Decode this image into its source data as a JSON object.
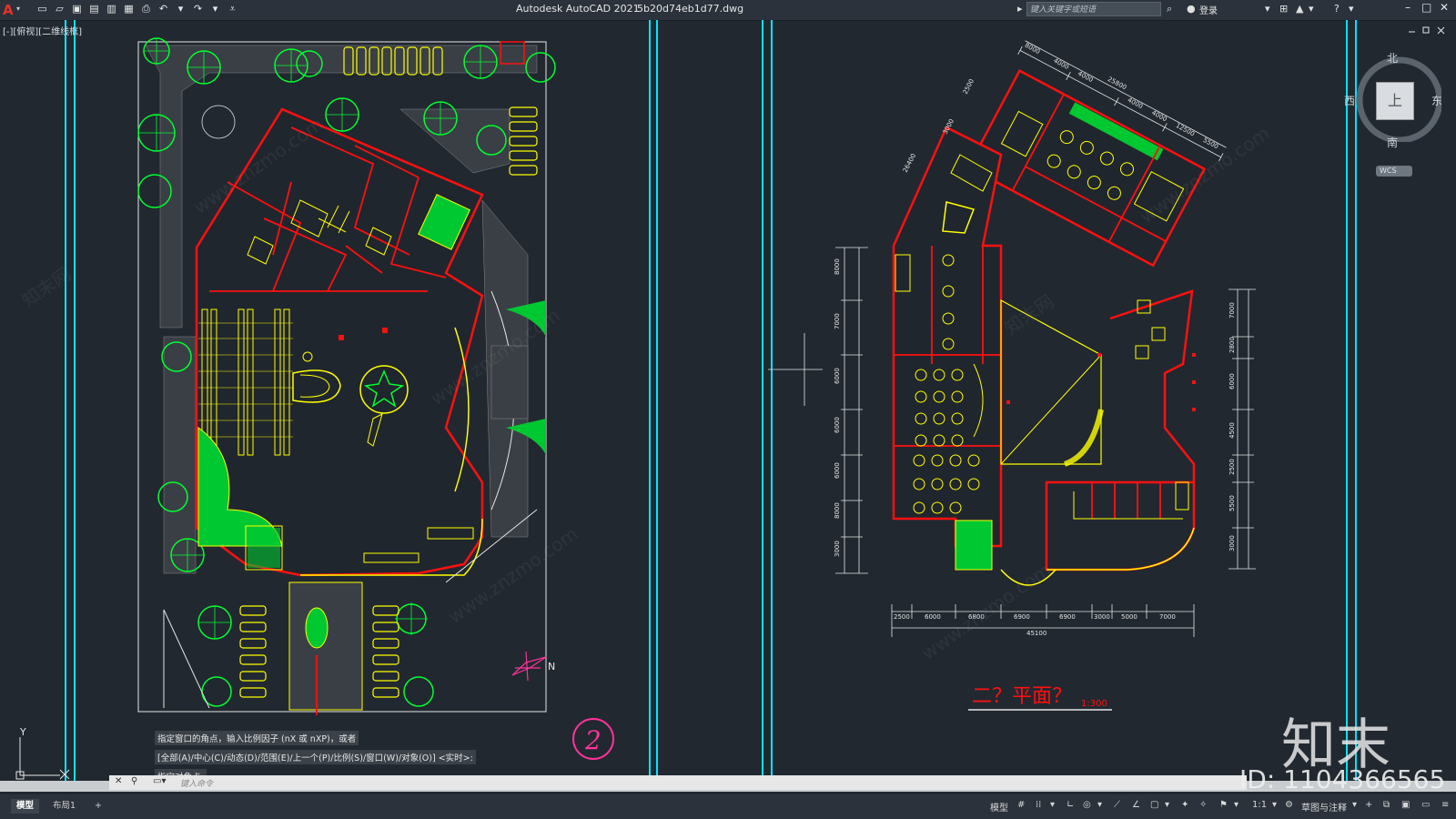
{
  "app": {
    "title": "Autodesk AutoCAD 2021",
    "filename": "5b20d74eb1d77.dwg",
    "logo": "A",
    "search_placeholder": "键入关键字或短语",
    "login_label": "登录"
  },
  "viewport": {
    "label": "[-][俯视][二维线框]"
  },
  "viewcube": {
    "north": "北",
    "south": "南",
    "west": "西",
    "east": "东",
    "top": "上",
    "wcs": "WCS"
  },
  "drawing": {
    "left_plan_circle_label": "2",
    "north_arrow_label": "N",
    "right_plan_title": "二？平面？",
    "right_plan_scale": "1:300",
    "ucs_y": "Y",
    "ucs_x": "X",
    "dims_vertical": [
      "8000",
      "7000",
      "6000",
      "6000",
      "6000",
      "8000",
      "3000"
    ],
    "dims_bottom": [
      "2500",
      "6000",
      "6800",
      "6900",
      "6900",
      "3000",
      "5000",
      "7000"
    ],
    "dim_total_bottom": "45100",
    "dims_right": [
      "7000",
      "2800",
      "6000",
      "4500",
      "2500",
      "5500",
      "3000"
    ],
    "dims_top": [
      "8000",
      "4000",
      "4000",
      "25800",
      "4000",
      "4000",
      "12500",
      "5500"
    ],
    "dims_topleft": [
      "26400",
      "3000",
      "2500"
    ]
  },
  "command": {
    "history": [
      "指定窗口的角点，输入比例因子 (nX 或 nXP)，或者",
      "[全部(A)/中心(C)/动态(D)/范围(E)/上一个(P)/比例(S)/窗口(W)/对象(O)] <实时>:",
      "指定对角点:"
    ],
    "placeholder": "键入命令"
  },
  "status": {
    "tab_model": "模型",
    "tab_layout1": "布局1",
    "add_tab": "+",
    "model_label": "模型",
    "scale": "1:1",
    "workspace": "草图与注释"
  },
  "watermark": {
    "site": "www.znzmo.com",
    "site_cn": "知末网",
    "brand": "知末",
    "id": "ID: 1104366565"
  },
  "colors": {
    "bg": "#212830",
    "wall": "#ff1010",
    "line": "#ffff00",
    "green": "#00ff30",
    "white": "#e6e6e6",
    "cyan": "#00e5ff",
    "magenta": "#ff3399"
  }
}
